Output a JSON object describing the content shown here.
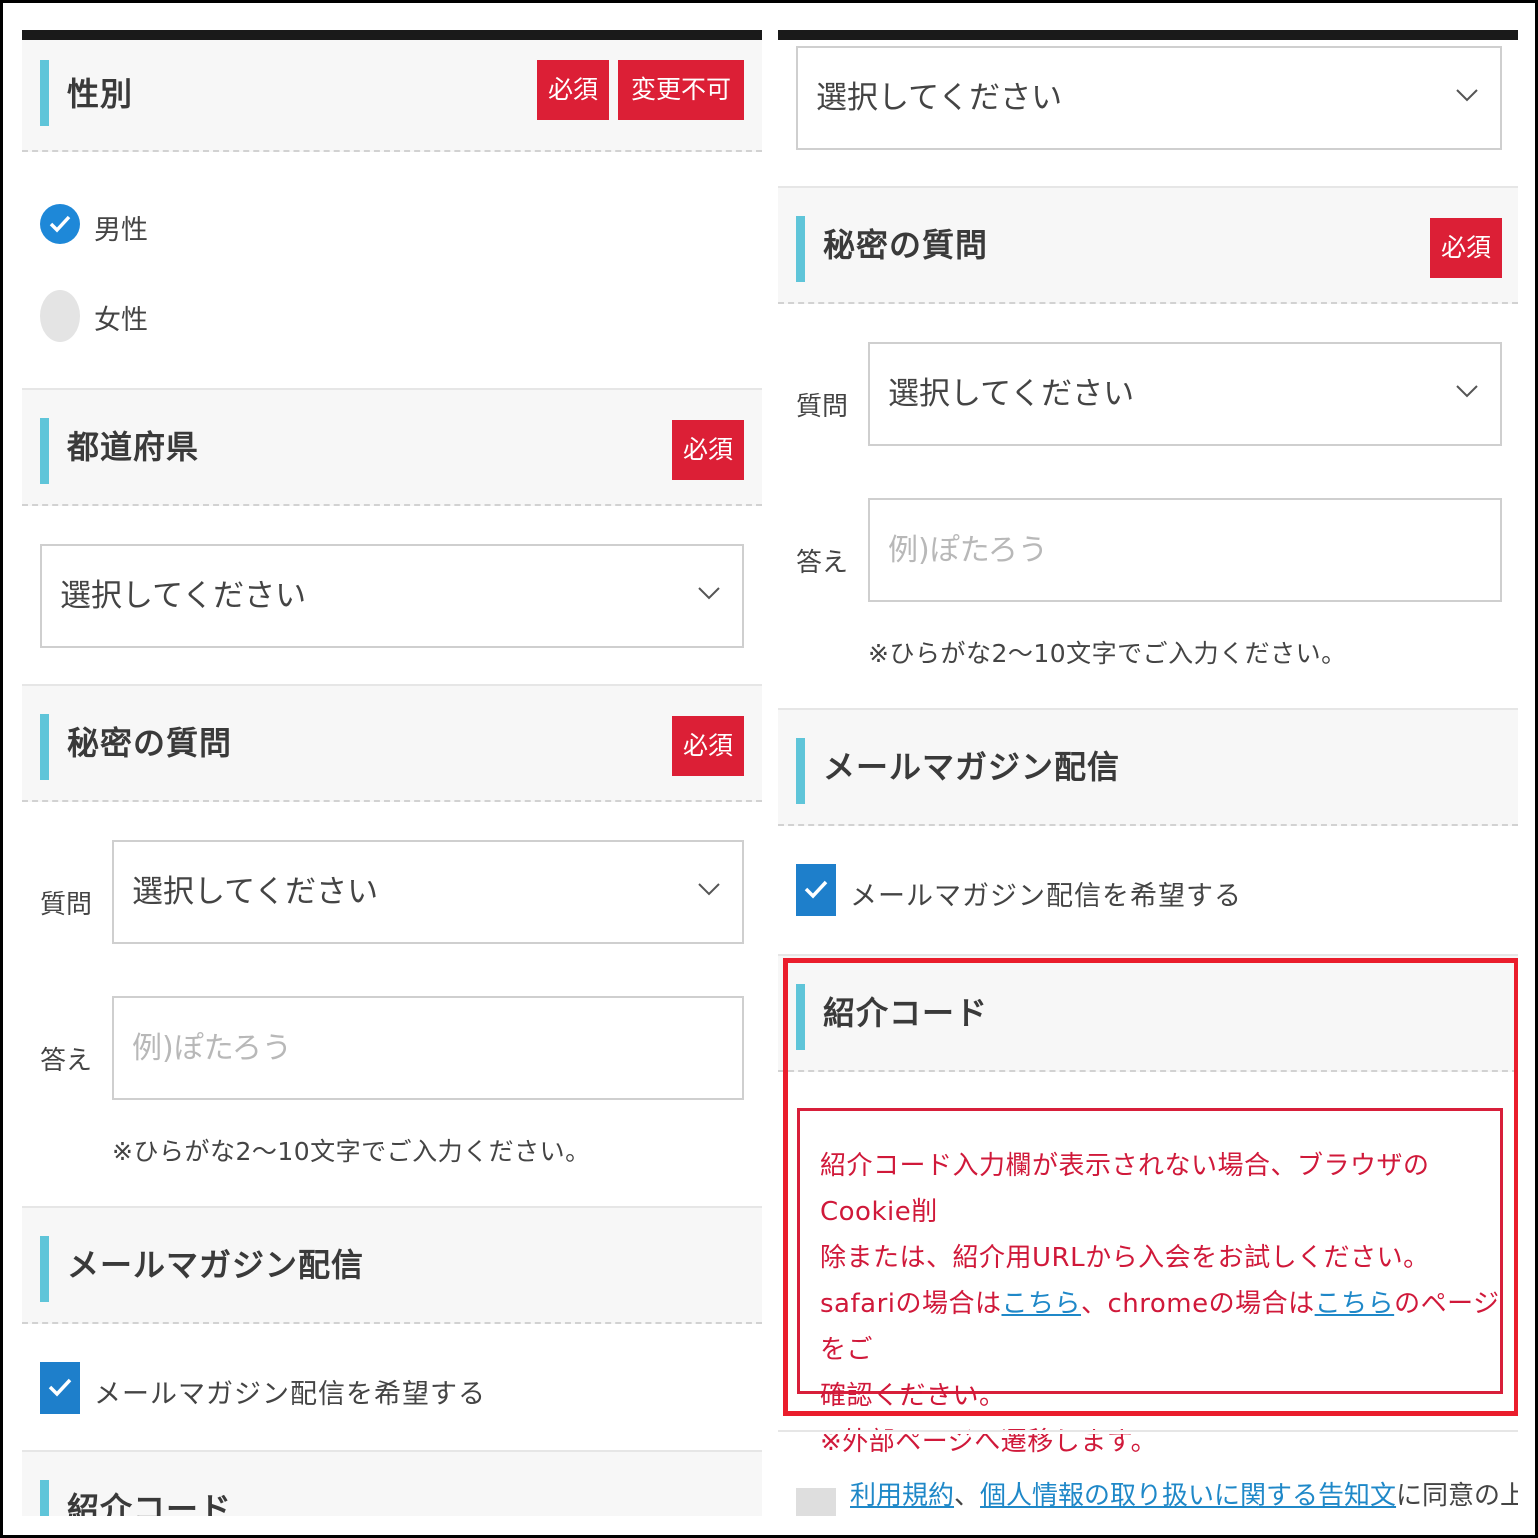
{
  "left": {
    "gender": {
      "title": "性別",
      "badge_required": "必須",
      "badge_locked": "変更不可",
      "options": [
        "男性",
        "女性"
      ],
      "selected": "男性"
    },
    "prefecture": {
      "title": "都道府県",
      "badge_required": "必須",
      "select_value": "選択してください"
    },
    "secret": {
      "title": "秘密の質問",
      "badge_required": "必須",
      "question_label": "質問",
      "question_value": "選択してください",
      "answer_label": "答え",
      "answer_placeholder": "例)ぽたろう",
      "hint": "※ひらがな2〜10文字でご入力ください。"
    },
    "newsletter": {
      "title": "メールマガジン配信",
      "checkbox_label": "メールマガジン配信を希望する"
    },
    "referral": {
      "title": "紹介コード"
    }
  },
  "right": {
    "top_select_value": "選択してください",
    "secret": {
      "title": "秘密の質問",
      "badge_required": "必須",
      "question_label": "質問",
      "question_value": "選択してください",
      "answer_label": "答え",
      "answer_placeholder": "例)ぽたろう",
      "hint": "※ひらがな2〜10文字でご入力ください。"
    },
    "newsletter": {
      "title": "メールマガジン配信",
      "checkbox_label": "メールマガジン配信を希望する"
    },
    "referral": {
      "title": "紹介コード",
      "notice": {
        "line1": "紹介コード入力欄が表示されない場合、ブラウザのCookie削",
        "line2": "除または、紹介用URLから入会をお試しください。",
        "line3_a": "safariの場合は",
        "link_safari": "こちら",
        "line3_b": "、chromeの場合は",
        "link_chrome": "こちら",
        "line3_c": "のページをご",
        "line4": "確認ください。",
        "line5": "※外部ページへ遷移します。"
      }
    },
    "terms": {
      "link_terms": "利用規約",
      "sep": "、",
      "link_privacy": "個人情報の取り扱いに関する告知文",
      "suffix": "に同意の上、"
    }
  },
  "colors": {
    "accent": "#5fc5d9",
    "required_badge": "#dc1f36",
    "check_blue": "#1e7fcb",
    "notice_red": "#d0193a",
    "link_blue": "#1f88c8"
  },
  "icons": [
    "check-icon",
    "chevron-down-icon"
  ]
}
